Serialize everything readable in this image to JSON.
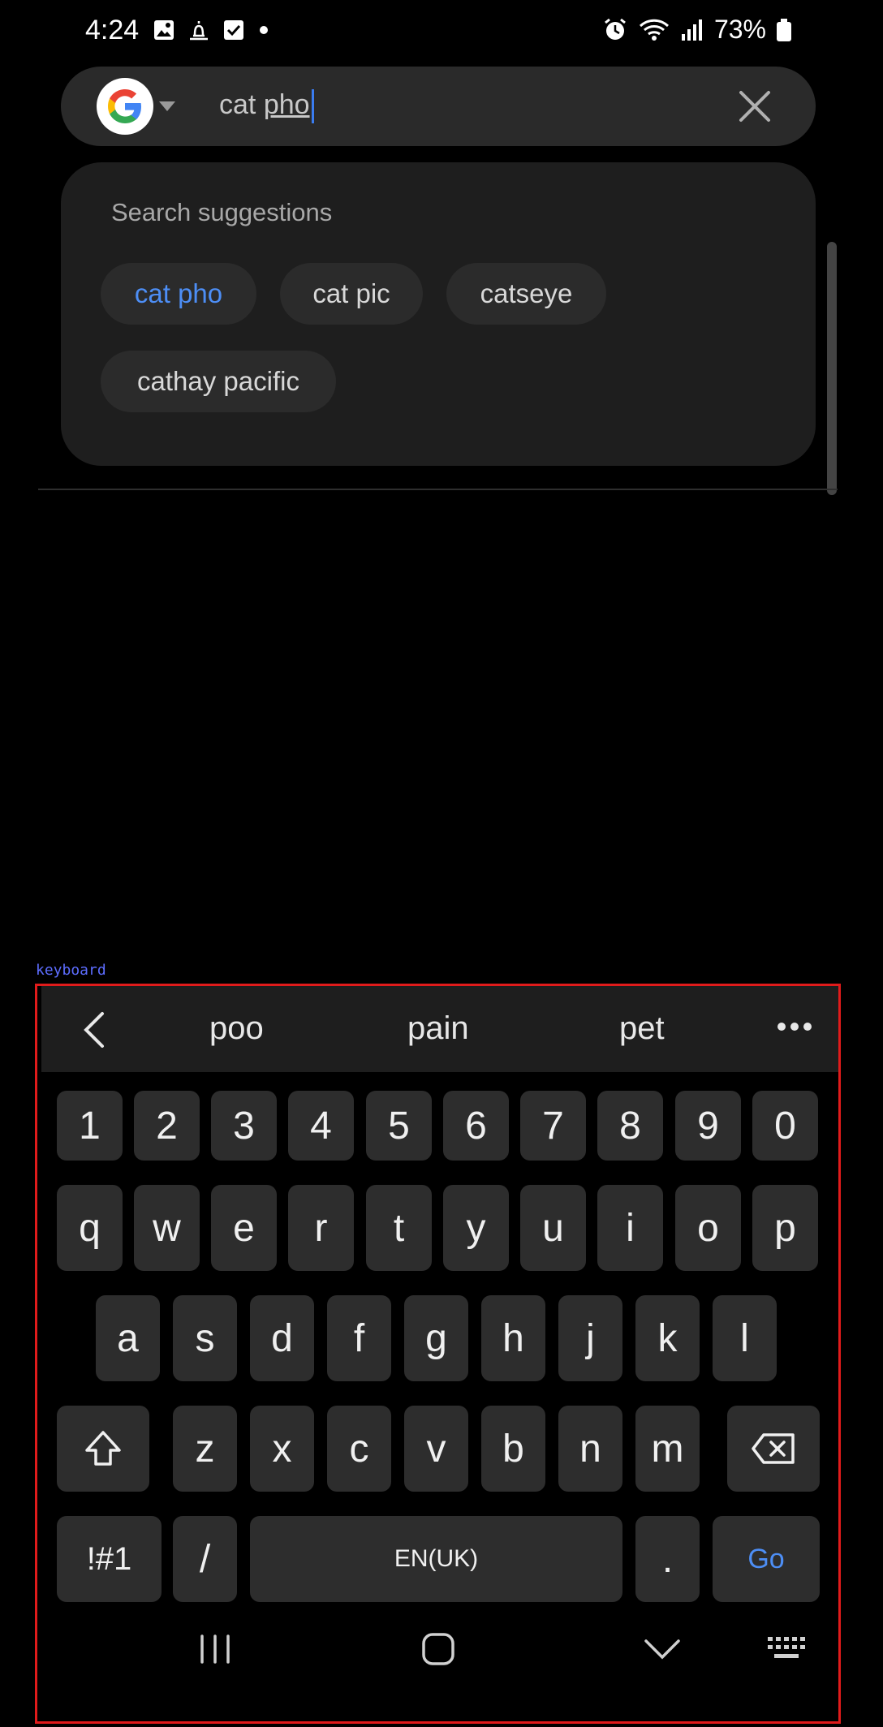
{
  "status_bar": {
    "time": "4:24",
    "battery": "73%"
  },
  "search": {
    "query_prefix": "cat ",
    "query_composing": "pho",
    "engine_icon": "google-icon",
    "clear_icon": "close-icon"
  },
  "suggestions": {
    "title": "Search suggestions",
    "chips": [
      "cat pho",
      "cat pic",
      "catseye",
      "cathay pacific"
    ]
  },
  "keyboard": {
    "label": "keyboard",
    "predictions": [
      "poo",
      "pain",
      "pet"
    ],
    "number_row": [
      "1",
      "2",
      "3",
      "4",
      "5",
      "6",
      "7",
      "8",
      "9",
      "0"
    ],
    "row1": [
      "q",
      "w",
      "e",
      "r",
      "t",
      "y",
      "u",
      "i",
      "o",
      "p"
    ],
    "row2": [
      "a",
      "s",
      "d",
      "f",
      "g",
      "h",
      "j",
      "k",
      "l"
    ],
    "row3": [
      "z",
      "x",
      "c",
      "v",
      "b",
      "n",
      "m"
    ],
    "symbols_key": "!#1",
    "slash_key": "/",
    "space_key": "EN(UK)",
    "period_key": ".",
    "go_key": "Go"
  },
  "colors": {
    "accent": "#4d8ef5",
    "chip_bg": "#2b2b2b",
    "key_bg": "#2d2d2d",
    "highlight_frame": "#e01b1b"
  }
}
